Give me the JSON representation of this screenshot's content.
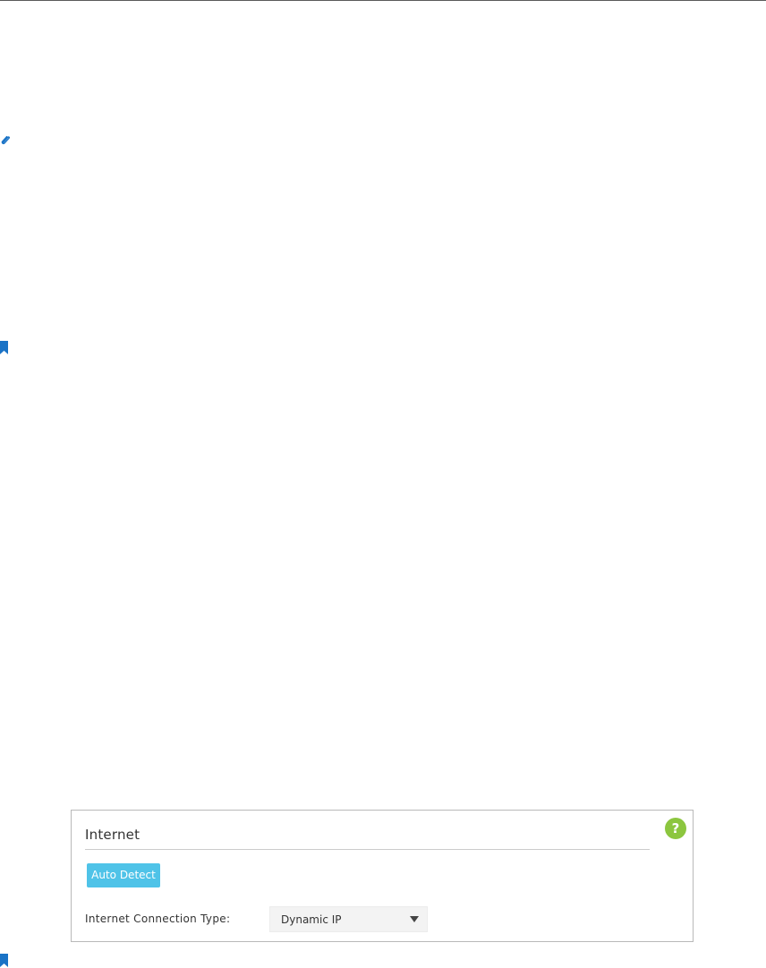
{
  "colors": {
    "icon_blue": "#1a73c6",
    "help_green": "#8cc63f",
    "button_cyan": "#4fc3e8"
  },
  "icons": {
    "margin_top": "paperclip-icon",
    "margin_middle": "bookmark-icon",
    "margin_bottom": "bookmark-icon",
    "help": "help-icon",
    "dropdown": "caret-down-icon"
  },
  "internet_panel": {
    "title": "Internet",
    "help_glyph": "?",
    "auto_detect_label": "Auto Detect",
    "connection_type": {
      "label": "Internet Connection Type:",
      "selected": "Dynamic IP"
    }
  }
}
